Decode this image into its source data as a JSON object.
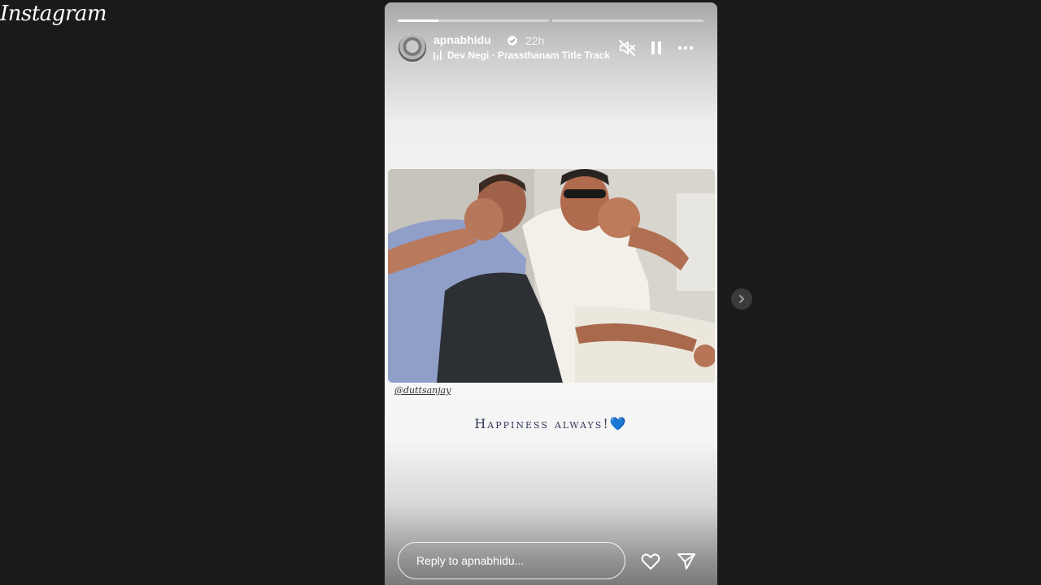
{
  "app": {
    "logo_text": "Instagram"
  },
  "story": {
    "progress": [
      0.27,
      0
    ],
    "username": "apnabhidu",
    "age": "22h",
    "music": "Dev Negi · Prassthanam Title Track",
    "photo_mention": "@duttsanjay",
    "caption_text": "Happiness always!",
    "caption_emoji": "💙",
    "reply_placeholder": "Reply to apnabhidu..."
  },
  "icons": {
    "mute": "speaker-muted-icon",
    "pause": "pause-icon",
    "more": "more-horizontal-icon",
    "like": "heart-outline-icon",
    "share": "paper-plane-icon",
    "next": "chevron-right-icon",
    "verified": "verified-badge-icon"
  },
  "colors": {
    "page_bg": "#1a1a1a",
    "caption": "#303a55",
    "verified": "#ffffff"
  }
}
